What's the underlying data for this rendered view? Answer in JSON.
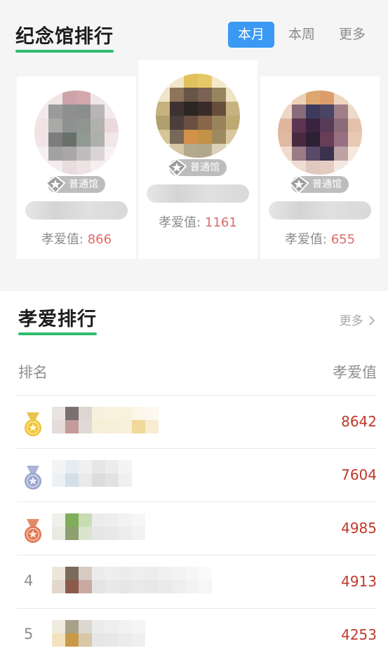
{
  "memorial": {
    "title": "纪念馆排行",
    "tabs": [
      {
        "label": "本月",
        "active": true
      },
      {
        "label": "本周",
        "active": false
      },
      {
        "label": "更多",
        "active": false
      }
    ],
    "halls": [
      {
        "badge": "普通馆",
        "score_label": "孝爱值:",
        "score": "866"
      },
      {
        "badge": "普通馆",
        "score_label": "孝爱值:",
        "score": "1161"
      },
      {
        "badge": "普通馆",
        "score_label": "孝爱值:",
        "score": "655"
      }
    ]
  },
  "filial": {
    "title": "孝爱排行",
    "more": "更多",
    "col_rank": "排名",
    "col_value": "孝爱值",
    "rows": [
      {
        "rank": "",
        "medal": "gold-medal-icon",
        "value": "8642"
      },
      {
        "rank": "",
        "medal": "silver-medal-icon",
        "value": "7604"
      },
      {
        "rank": "",
        "medal": "bronze-medal-icon",
        "value": "4985"
      },
      {
        "rank": "4",
        "medal": "",
        "value": "4913"
      },
      {
        "rank": "5",
        "medal": "",
        "value": "4253"
      }
    ]
  },
  "colors": {
    "accent_green": "#2ebd6e",
    "tab_active": "#3a99f3",
    "score_red": "#c0392b"
  }
}
